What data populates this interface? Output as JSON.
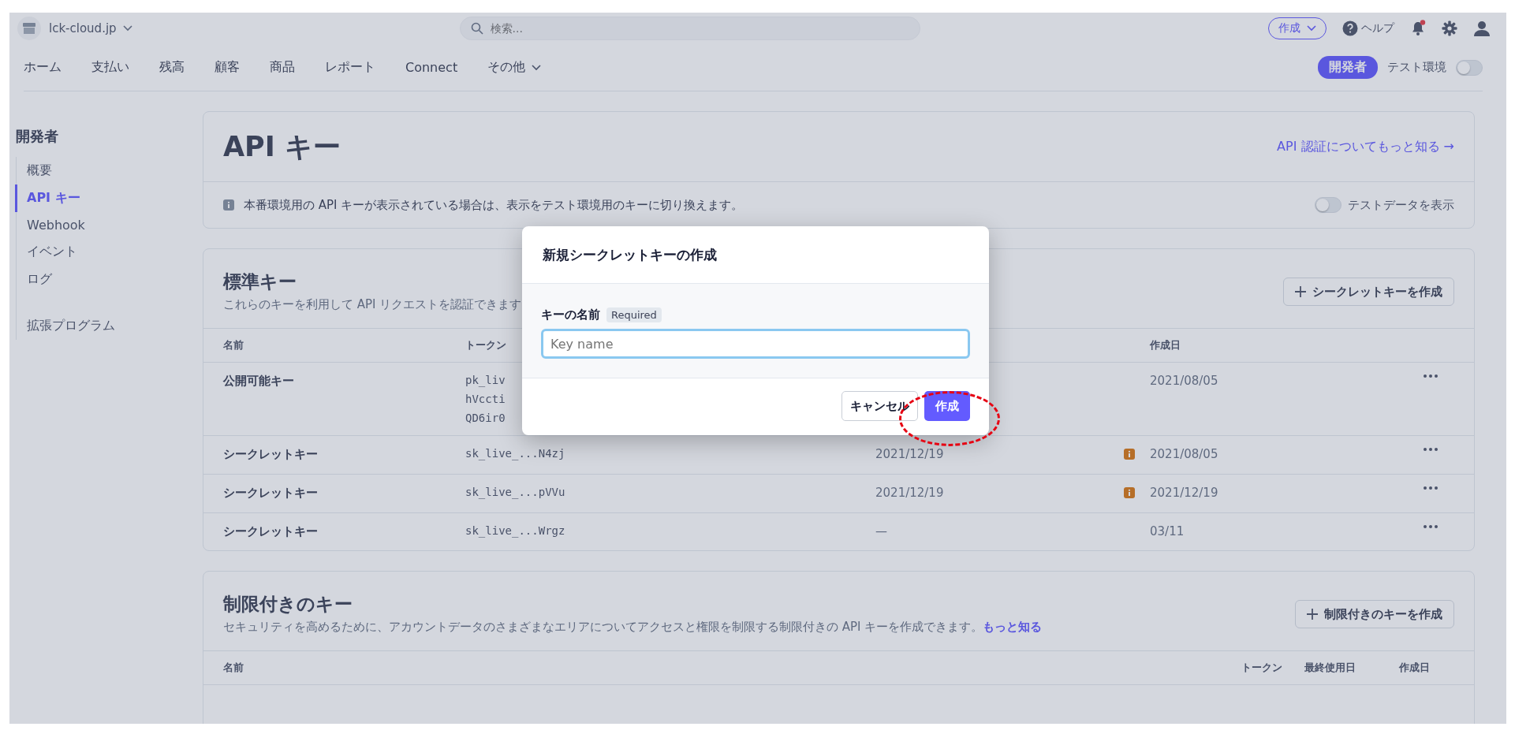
{
  "account": {
    "name": "lck-cloud.jp"
  },
  "search": {
    "placeholder": "検索..."
  },
  "top_actions": {
    "create": "作成",
    "help": "ヘルプ",
    "notification_unread": true
  },
  "nav": {
    "items": [
      "ホーム",
      "支払い",
      "残高",
      "顧客",
      "商品",
      "レポート",
      "Connect"
    ],
    "more": "その他",
    "developer_badge": "開発者",
    "test_mode": {
      "label": "テスト環境",
      "on": false
    }
  },
  "sidebar": {
    "title": "開発者",
    "items": [
      {
        "label": "概要",
        "selected": false
      },
      {
        "label": "API キー",
        "selected": true
      },
      {
        "label": "Webhook",
        "selected": false
      },
      {
        "label": "イベント",
        "selected": false
      },
      {
        "label": "ログ",
        "selected": false
      }
    ],
    "extensions": "拡張プログラム"
  },
  "page": {
    "title": "API キー",
    "learn_more": "API 認証についてもっと知る →",
    "info": "本番環境用の API キーが表示されている場合は、表示をテスト環境用のキーに切り換えます。",
    "test_data": {
      "label": "テストデータを表示",
      "on": false
    }
  },
  "standard_keys": {
    "title": "標準キー",
    "description": "これらのキーを利用して API リクエストを認証できます",
    "create_button": "シークレットキーを作成",
    "columns": {
      "name": "名前",
      "token": "トークン",
      "created": "作成日"
    },
    "rows": [
      {
        "name": "公開可能キー",
        "token_lines": [
          "pk_liv",
          "hVccti",
          "QD6ir0"
        ],
        "warning": false,
        "created": "2021/08/05"
      },
      {
        "name": "シークレットキー",
        "token_lines": [
          "sk_live_...N4zj"
        ],
        "last_used": "2021/12/19",
        "warning": true,
        "created": "2021/08/05"
      },
      {
        "name": "シークレットキー",
        "token_lines": [
          "sk_live_...pVVu"
        ],
        "last_used": "2021/12/19",
        "warning": true,
        "created": "2021/12/19"
      },
      {
        "name": "シークレットキー",
        "token_lines": [
          "sk_live_...Wrgz"
        ],
        "last_used": "—",
        "warning": false,
        "created": "03/11"
      }
    ]
  },
  "restricted_keys": {
    "title": "制限付きのキー",
    "description": "セキュリティを高めるために、アカウントデータのさまざまなエリアについてアクセスと権限を制限する制限付きの API キーを作成できます。",
    "link": "もっと知る",
    "create_button": "制限付きのキーを作成",
    "columns": {
      "name": "名前",
      "token": "トークン",
      "last_used": "最終使用日",
      "created": "作成日"
    }
  },
  "modal": {
    "title": "新規シークレットキーの作成",
    "field_label": "キーの名前",
    "required_badge": "Required",
    "placeholder": "Key name",
    "cancel": "キャンセル",
    "submit": "作成"
  }
}
